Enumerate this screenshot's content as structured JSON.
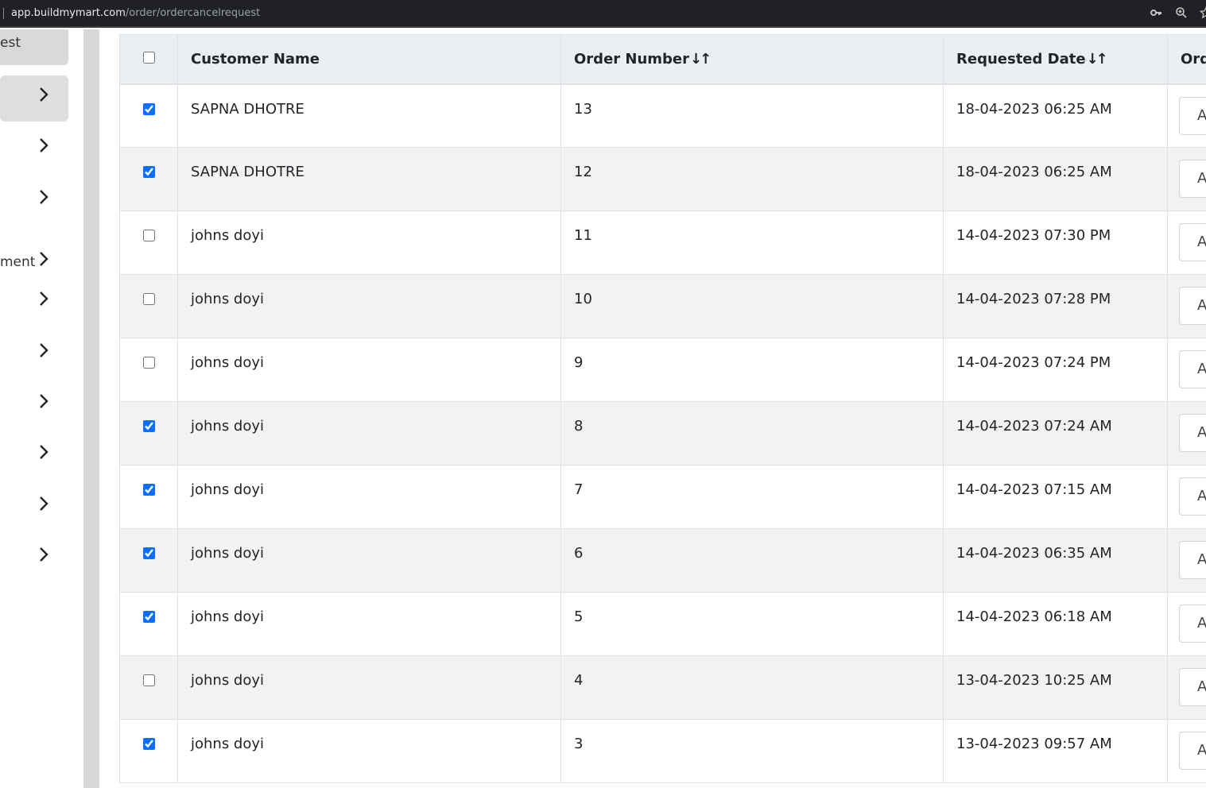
{
  "browser": {
    "url_host": "app.buildmymart.com",
    "url_path": "/order/ordercancelrequest",
    "icons": [
      "key-icon",
      "zoom-icon",
      "star-icon"
    ]
  },
  "sidebar": {
    "items": [
      {
        "label": "est",
        "chevron": false
      },
      {
        "label": "",
        "chevron": true,
        "active": true
      },
      {
        "label": "",
        "chevron": true
      },
      {
        "label": "",
        "chevron": true
      },
      {
        "label": "ment",
        "chevron": true
      },
      {
        "label": "",
        "chevron": true
      },
      {
        "label": "",
        "chevron": true
      },
      {
        "label": "",
        "chevron": true
      },
      {
        "label": "",
        "chevron": true
      },
      {
        "label": "",
        "chevron": true
      },
      {
        "label": "",
        "chevron": true
      }
    ]
  },
  "table": {
    "headers": {
      "customer_name": "Customer Name",
      "order_number": "Order Number",
      "requested_date": "Requested Date",
      "order_status": "Ord",
      "sort_glyph": "↓↑"
    },
    "select_all_checked": false,
    "action_label": "A",
    "rows": [
      {
        "checked": true,
        "customer": "SAPNA DHOTRE",
        "order": "13",
        "date": "18-04-2023 06:25 AM"
      },
      {
        "checked": true,
        "customer": "SAPNA DHOTRE",
        "order": "12",
        "date": "18-04-2023 06:25 AM"
      },
      {
        "checked": false,
        "customer": "johns doyi",
        "order": "11",
        "date": "14-04-2023 07:30 PM"
      },
      {
        "checked": false,
        "customer": "johns doyi",
        "order": "10",
        "date": "14-04-2023 07:28 PM"
      },
      {
        "checked": false,
        "customer": "johns doyi",
        "order": "9",
        "date": "14-04-2023 07:24 PM"
      },
      {
        "checked": true,
        "customer": "johns doyi",
        "order": "8",
        "date": "14-04-2023 07:24 AM"
      },
      {
        "checked": true,
        "customer": "johns doyi",
        "order": "7",
        "date": "14-04-2023 07:15 AM"
      },
      {
        "checked": true,
        "customer": "johns doyi",
        "order": "6",
        "date": "14-04-2023 06:35 AM"
      },
      {
        "checked": true,
        "customer": "johns doyi",
        "order": "5",
        "date": "14-04-2023 06:18 AM"
      },
      {
        "checked": false,
        "customer": "johns doyi",
        "order": "4",
        "date": "13-04-2023 10:25 AM"
      },
      {
        "checked": true,
        "customer": "johns doyi",
        "order": "3",
        "date": "13-04-2023 09:57 AM"
      }
    ]
  }
}
